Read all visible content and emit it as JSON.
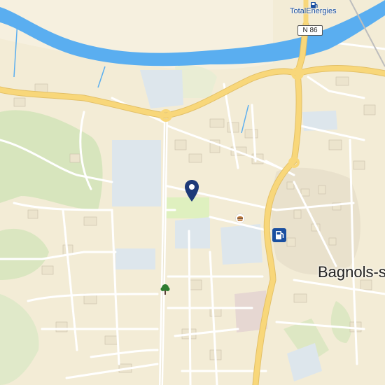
{
  "map": {
    "place_label": "Bagnols-su",
    "poi_label": "TotalEnergies",
    "road_shield": "N 86",
    "icons": [
      "fuel-station-icon",
      "restaurant-icon",
      "park-tree-icon",
      "location-pin-icon"
    ]
  },
  "colors": {
    "land": "#f3ecd6",
    "river": "#5aaef0",
    "major_road": "#f8d77a",
    "park": "#cfe4b6",
    "building": "#d8dde2",
    "pin": "#1e3a78",
    "poi": "#1a4fa0"
  }
}
